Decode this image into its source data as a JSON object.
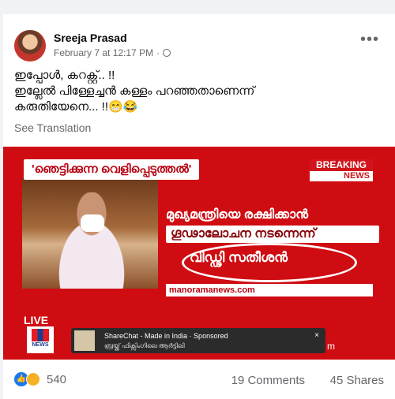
{
  "post": {
    "author": "Sreeja Prasad",
    "timestamp": "February 7 at 12:17 PM",
    "audience_icon": "globe-icon",
    "menu_icon": "more-options-icon",
    "text_lines": [
      "ഇപ്പോൾ, കറക്റ്റ്.. !!",
      "ഇല്ലേൽ പിള്ളേച്ചൻ കള്ളം പറഞ്ഞതാണെന്ന്",
      "കരുതിയേനെ... !!😁😂"
    ],
    "see_translation": "See Translation"
  },
  "media": {
    "banner": "'ഞെട്ടിക്കുന്ന വെളിപ്പെടുത്തൽ'",
    "breaking_top": "BREAKING",
    "breaking_bottom": "NEWS",
    "headline_1": "മുഖ്യമന്ത്രിയെ രക്ഷിക്കാൻ",
    "headline_2": "ഗൂഢാലോചന നടന്നെന്ന്",
    "headline_3": "വിഡ്ഢി സതീശൻ",
    "site": "manoramanews.com",
    "live": "LIVE",
    "logo_text": "NEWS",
    "ad_title": "ShareChat - Made in India · Sponsored",
    "ad_subtitle": "ബ്രയ്ക്ക് ഫിക്സിംഗിലെ ആർട്ടിലി",
    "ad_close": "×",
    "cut_text": "m"
  },
  "footer": {
    "reaction_count": "540",
    "comments": "19 Comments",
    "shares": "45 Shares"
  },
  "colors": {
    "brand": "#1877f2",
    "news_red": "#cf0c12"
  }
}
